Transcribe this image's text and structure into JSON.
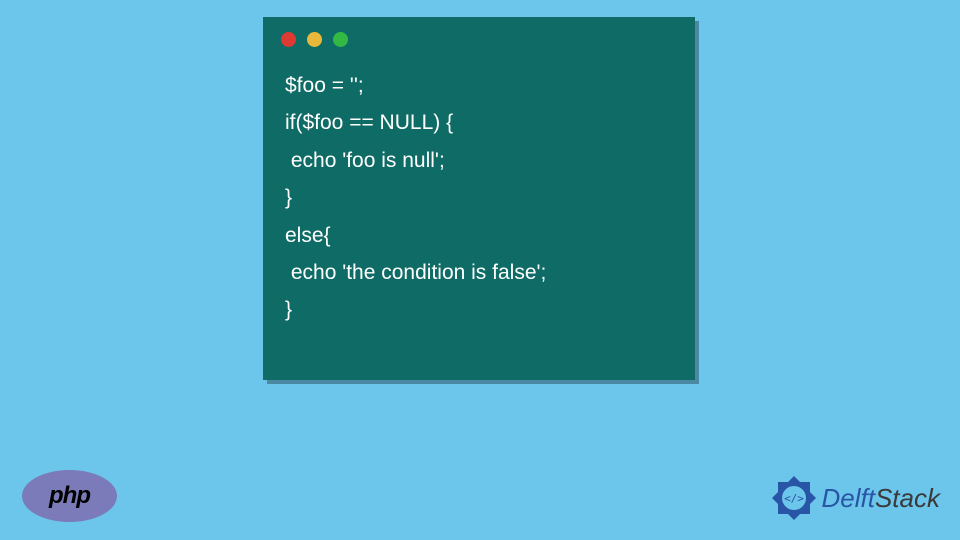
{
  "code": {
    "line1": "$foo = '';",
    "line2": "if($foo == NULL) {",
    "line3": " echo 'foo is null';",
    "line4": "}",
    "line5": "else{",
    "line6": " echo 'the condition is false';",
    "line7": "}"
  },
  "php_logo": "php",
  "delft_logo": {
    "part1": "Delft",
    "part2": "Stack"
  }
}
